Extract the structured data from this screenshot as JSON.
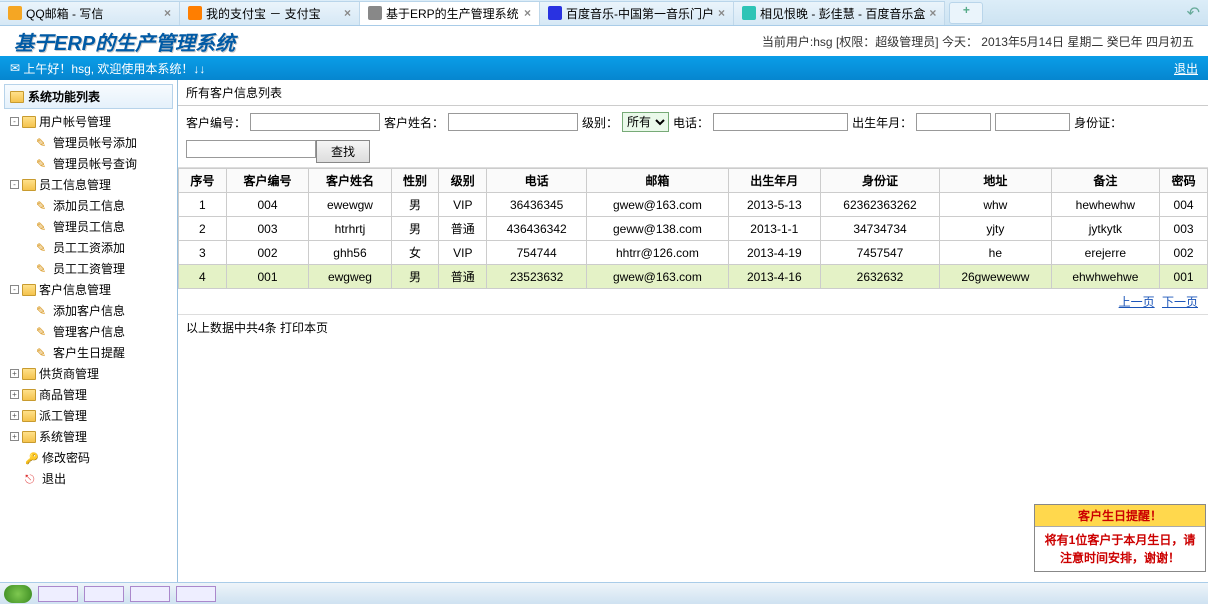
{
  "tabs": [
    {
      "icon": "mail",
      "label": "QQ邮箱 - 写信"
    },
    {
      "icon": "alipay",
      "label": "我的支付宝 － 支付宝"
    },
    {
      "icon": "page",
      "label": "基于ERP的生产管理系统",
      "active": true
    },
    {
      "icon": "baidu",
      "label": "百度音乐-中国第一音乐门户"
    },
    {
      "icon": "music",
      "label": "相见恨晚 - 彭佳慧 - 百度音乐盒"
    }
  ],
  "app_title": "基于ERP的生产管理系统",
  "user_info": "当前用户:hsg [权限：超级管理员] 今天： 2013年5月14日 星期二 癸巳年 四月初五",
  "greeting": "上午好！hsg, 欢迎使用本系统！↓↓",
  "logout_label": "退出",
  "sidebar": {
    "header": "系统功能列表",
    "nodes": [
      {
        "type": "folder",
        "label": "用户帐号管理",
        "open": true,
        "children": [
          {
            "label": "管理员帐号添加"
          },
          {
            "label": "管理员帐号查询"
          }
        ]
      },
      {
        "type": "folder",
        "label": "员工信息管理",
        "open": true,
        "children": [
          {
            "label": "添加员工信息"
          },
          {
            "label": "管理员工信息"
          },
          {
            "label": "员工工资添加"
          },
          {
            "label": "员工工资管理"
          }
        ]
      },
      {
        "type": "folder",
        "label": "客户信息管理",
        "open": true,
        "children": [
          {
            "label": "添加客户信息"
          },
          {
            "label": "管理客户信息"
          },
          {
            "label": "客户生日提醒"
          }
        ]
      },
      {
        "type": "folder",
        "label": "供货商管理"
      },
      {
        "type": "folder",
        "label": "商品管理"
      },
      {
        "type": "folder",
        "label": "派工管理"
      },
      {
        "type": "folder",
        "label": "系统管理"
      },
      {
        "type": "leaf",
        "icon": "key",
        "label": "修改密码"
      },
      {
        "type": "leaf",
        "icon": "exit",
        "label": "退出"
      }
    ]
  },
  "panel": {
    "title": "所有客户信息列表",
    "filters": {
      "id_label": "客户编号：",
      "name_label": "客户姓名：",
      "level_label": "级别：",
      "level_value": "所有",
      "phone_label": "电话：",
      "birth_label": "出生年月：",
      "idcard_label": "身份证：",
      "search_btn": "查找"
    },
    "columns": [
      "序号",
      "客户编号",
      "客户姓名",
      "性别",
      "级别",
      "电话",
      "邮箱",
      "出生年月",
      "身份证",
      "地址",
      "备注",
      "密码"
    ],
    "rows": [
      [
        "1",
        "004",
        "ewewgw",
        "男",
        "VIP",
        "36436345",
        "gwew@163.com",
        "2013-5-13",
        "62362363262",
        "whw",
        "hewhewhw",
        "004"
      ],
      [
        "2",
        "003",
        "htrhrtj",
        "男",
        "普通",
        "436436342",
        "geww@138.com",
        "2013-1-1",
        "34734734",
        "yjty",
        "jytkytk",
        "003"
      ],
      [
        "3",
        "002",
        "ghh56",
        "女",
        "VIP",
        "754744",
        "hhtrr@126.com",
        "2013-4-19",
        "7457547",
        "he",
        "erejerre",
        "002"
      ],
      [
        "4",
        "001",
        "ewgweg",
        "男",
        "普通",
        "23523632",
        "gwew@163.com",
        "2013-4-16",
        "2632632",
        "26gweweww",
        "ehwhwehwe",
        "001"
      ]
    ],
    "selected_row": 3,
    "pager": {
      "prev": "上一页",
      "next": "下一页"
    },
    "summary": "以上数据中共4条  打印本页"
  },
  "reminder": {
    "title": "客户生日提醒！",
    "body": "将有1位客户于本月生日，请注意时间安排，谢谢！"
  }
}
